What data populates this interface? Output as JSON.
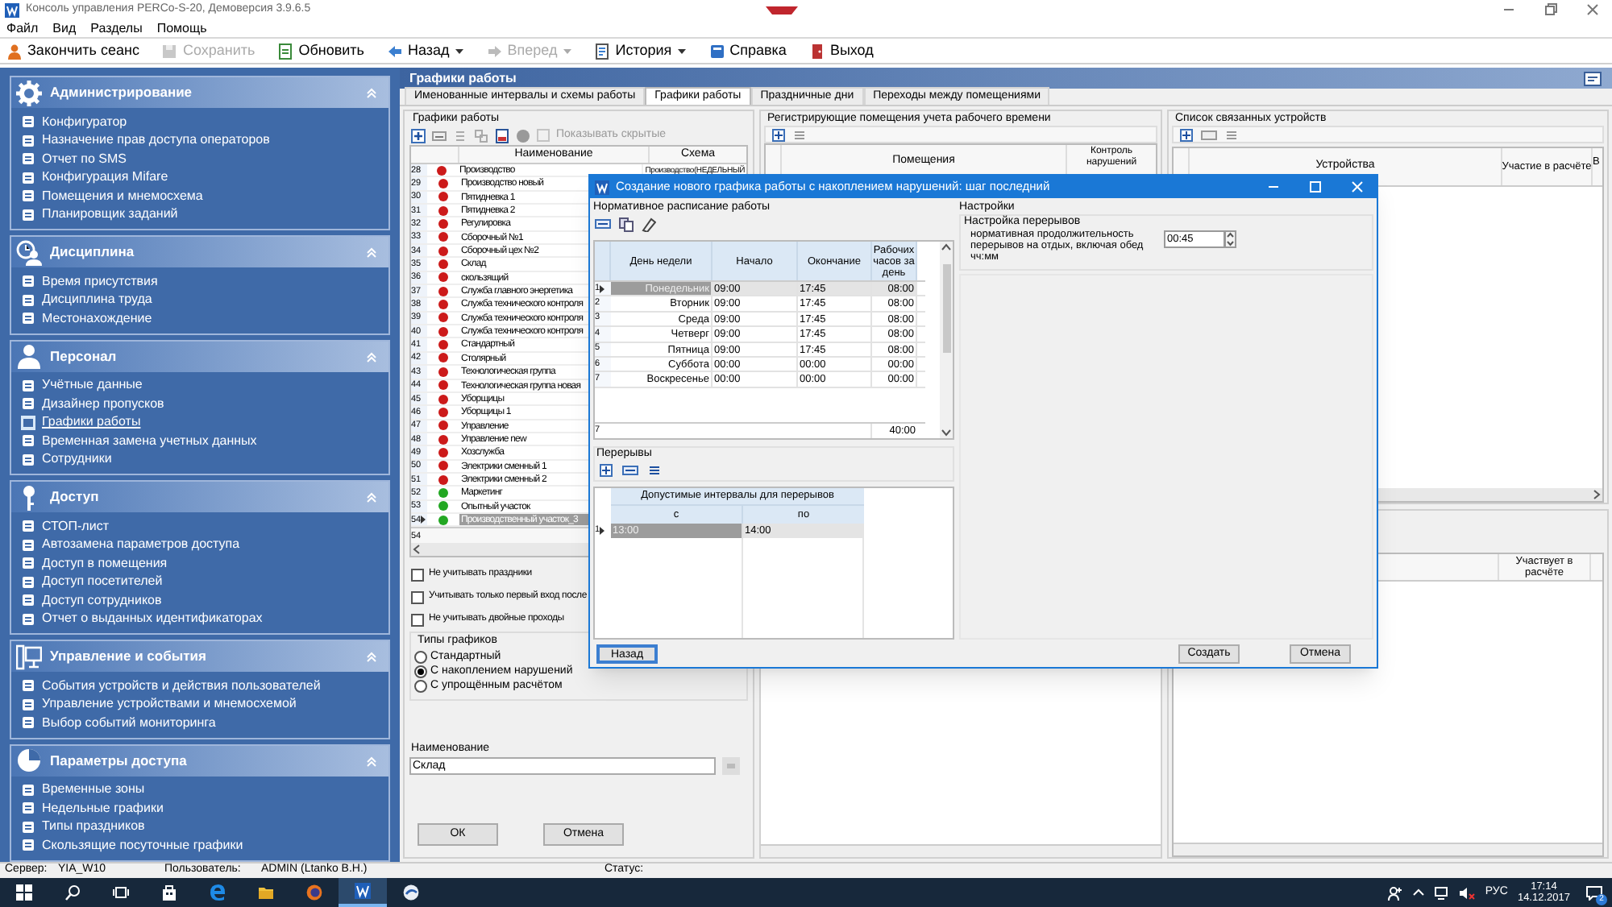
{
  "window": {
    "title": "Консоль управления PERCo-S-20, Демоверсия 3.9.6.5"
  },
  "menu": [
    "Файл",
    "Вид",
    "Разделы",
    "Помощь"
  ],
  "toolbar": [
    {
      "label": "Закончить сеанс",
      "disabled": false,
      "dropdown": false
    },
    {
      "label": "Сохранить",
      "disabled": true,
      "dropdown": false
    },
    {
      "label": "Обновить",
      "disabled": false,
      "dropdown": false
    },
    {
      "label": "Назад",
      "disabled": false,
      "dropdown": true
    },
    {
      "label": "Вперед",
      "disabled": true,
      "dropdown": true
    },
    {
      "label": "История",
      "disabled": false,
      "dropdown": true
    },
    {
      "label": "Справка",
      "disabled": false,
      "dropdown": false
    },
    {
      "label": "Выход",
      "disabled": false,
      "dropdown": false
    }
  ],
  "sidebar": {
    "sections": [
      {
        "title": "Администрирование",
        "items": [
          {
            "label": "Конфигуратор",
            "selected": false
          },
          {
            "label": "Назначение прав доступа операторов",
            "selected": false
          },
          {
            "label": "Отчет по SMS",
            "selected": false
          },
          {
            "label": "Конфигурация Mifare",
            "selected": false
          },
          {
            "label": "Помещения и мнемосхема",
            "selected": false
          },
          {
            "label": "Планировщик заданий",
            "selected": false
          }
        ]
      },
      {
        "title": "Дисциплина",
        "items": [
          {
            "label": "Время присутствия",
            "selected": false
          },
          {
            "label": "Дисциплина труда",
            "selected": false
          },
          {
            "label": "Местонахождение",
            "selected": false
          }
        ]
      },
      {
        "title": "Персонал",
        "items": [
          {
            "label": "Учётные данные",
            "selected": false
          },
          {
            "label": "Дизайнер пропусков",
            "selected": false
          },
          {
            "label": "Графики работы",
            "selected": true
          },
          {
            "label": "Временная замена учетных данных",
            "selected": false
          },
          {
            "label": "Сотрудники",
            "selected": false
          }
        ]
      },
      {
        "title": "Доступ",
        "items": [
          {
            "label": "СТОП-лист",
            "selected": false
          },
          {
            "label": "Автозамена параметров доступа",
            "selected": false
          },
          {
            "label": "Доступ в помещения",
            "selected": false
          },
          {
            "label": "Доступ посетителей",
            "selected": false
          },
          {
            "label": "Доступ сотрудников",
            "selected": false
          },
          {
            "label": "Отчет о выданных идентификаторах",
            "selected": false
          }
        ]
      },
      {
        "title": "Управление и события",
        "items": [
          {
            "label": "События устройств и действия пользователей",
            "selected": false
          },
          {
            "label": "Управление устройствами и мнемосхемой",
            "selected": false
          },
          {
            "label": "Выбор событий мониторинга",
            "selected": false
          }
        ]
      },
      {
        "title": "Параметры доступа",
        "items": [
          {
            "label": "Временные зоны",
            "selected": false
          },
          {
            "label": "Недельные графики",
            "selected": false
          },
          {
            "label": "Типы праздников",
            "selected": false
          },
          {
            "label": "Скользящие посуточные графики",
            "selected": false
          }
        ]
      }
    ]
  },
  "page_title": "Графики работы",
  "tabs": [
    {
      "label": "Именованные интервалы и схемы работы",
      "selected": false
    },
    {
      "label": "Графики работы",
      "selected": true
    },
    {
      "label": "Праздничные дни",
      "selected": false
    },
    {
      "label": "Переходы между помещениями",
      "selected": false
    }
  ],
  "schedules": {
    "title": "Графики работы",
    "show_hidden": {
      "label": "Показывать скрытые",
      "checked": false,
      "disabled": true
    },
    "columns": [
      "Наименование",
      "Схема"
    ],
    "rows": [
      {
        "number": "28",
        "name": "Производство",
        "scheme": "Производство(НЕДЕЛЬНЫЙ",
        "color": "#cc1a1a",
        "selected": false
      },
      {
        "number": "29",
        "name": "Производство новый",
        "color": "#cc1a1a",
        "selected": false
      },
      {
        "number": "30",
        "name": "Пятидневка 1",
        "color": "#cc1a1a",
        "selected": false
      },
      {
        "number": "31",
        "name": "Пятидневка 2",
        "color": "#cc1a1a",
        "selected": false
      },
      {
        "number": "32",
        "name": "Регулировка",
        "color": "#cc1a1a",
        "selected": false
      },
      {
        "number": "33",
        "name": "Сборочный №1",
        "color": "#cc1a1a",
        "selected": false
      },
      {
        "number": "34",
        "name": "Сборочный цех №2",
        "color": "#cc1a1a",
        "selected": false
      },
      {
        "number": "35",
        "name": "Склад",
        "color": "#cc1a1a",
        "selected": false
      },
      {
        "number": "36",
        "name": "скользящий",
        "color": "#cc1a1a",
        "selected": false
      },
      {
        "number": "37",
        "name": "Служба главного энергетика",
        "color": "#cc1a1a",
        "selected": false
      },
      {
        "number": "38",
        "name": "Служба технического контроля",
        "color": "#cc1a1a",
        "selected": false
      },
      {
        "number": "39",
        "name": "Служба технического контроля",
        "color": "#cc1a1a",
        "selected": false
      },
      {
        "number": "40",
        "name": "Служба технического контроля",
        "color": "#cc1a1a",
        "selected": false
      },
      {
        "number": "41",
        "name": "Стандартный",
        "color": "#cc1a1a",
        "selected": false
      },
      {
        "number": "42",
        "name": "Столярный",
        "color": "#cc1a1a",
        "selected": false
      },
      {
        "number": "43",
        "name": "Технологическая группа",
        "color": "#cc1a1a",
        "selected": false
      },
      {
        "number": "44",
        "name": "Технологическая группа новая",
        "color": "#cc1a1a",
        "selected": false
      },
      {
        "number": "45",
        "name": "Уборщицы",
        "color": "#cc1a1a",
        "selected": false
      },
      {
        "number": "46",
        "name": "Уборщицы 1",
        "color": "#cc1a1a",
        "selected": false
      },
      {
        "number": "47",
        "name": "Управление",
        "color": "#cc1a1a",
        "selected": false
      },
      {
        "number": "48",
        "name": "Управление new",
        "color": "#cc1a1a",
        "selected": false
      },
      {
        "number": "49",
        "name": "Хозслужба",
        "color": "#cc1a1a",
        "selected": false
      },
      {
        "number": "50",
        "name": "Электрики сменный 1",
        "color": "#cc1a1a",
        "selected": false
      },
      {
        "number": "51",
        "name": "Электрики сменный 2",
        "color": "#cc1a1a",
        "selected": false
      },
      {
        "number": "52",
        "name": "Маркетинг",
        "color": "#22a722",
        "selected": false
      },
      {
        "number": "53",
        "name": "Опытный участок",
        "color": "#22a722",
        "selected": false
      },
      {
        "number": "54",
        "name": "Производственный участок_3",
        "color": "#22a722",
        "selected": true
      }
    ],
    "footer": "54"
  },
  "options": [
    {
      "label": "Не учитывать праздники",
      "checked": false
    },
    {
      "label": "Учитывать только первый вход после",
      "checked": false
    },
    {
      "label": "Не учитывать двойные проходы",
      "checked": false
    }
  ],
  "schedule_types": {
    "title": "Типы графиков",
    "options": [
      {
        "label": "Стандартный",
        "selected": false
      },
      {
        "label": "С накоплением нарушений",
        "selected": true
      },
      {
        "label": "С упрощённым расчётом",
        "selected": false
      }
    ]
  },
  "name_field": {
    "label": "Наименование",
    "value": "Склад"
  },
  "buttons": [
    "ОК",
    "Отмена"
  ],
  "rooms_panel": {
    "title": "Регистрирующие помещения учета рабочего времени",
    "columns": [
      "Помещения",
      "Контроль нарушений"
    ]
  },
  "devices_panel": {
    "title": "Список связанных устройств",
    "columns": [
      "Устройства",
      "Участие в расчёте",
      "В"
    ]
  },
  "lower_panel": {
    "columns": [
      "Участвует в расчёте"
    ]
  },
  "dialog": {
    "title": "Создание нового графика работы с накоплением нарушений: шаг последний",
    "schedule": {
      "title": "Нормативное расписание работы",
      "columns": [
        "День недели",
        "Начало",
        "Окончание",
        "Рабочих часов за день"
      ],
      "rows": [
        {
          "number": "1",
          "day": "Понедельник",
          "start": "09:00",
          "end": "17:45",
          "hours": "08:00",
          "selected": true
        },
        {
          "number": "2",
          "day": "Вторник",
          "start": "09:00",
          "end": "17:45",
          "hours": "08:00",
          "selected": false
        },
        {
          "number": "3",
          "day": "Среда",
          "start": "09:00",
          "end": "17:45",
          "hours": "08:00",
          "selected": false
        },
        {
          "number": "4",
          "day": "Четверг",
          "start": "09:00",
          "end": "17:45",
          "hours": "08:00",
          "selected": false
        },
        {
          "number": "5",
          "day": "Пятница",
          "start": "09:00",
          "end": "17:45",
          "hours": "08:00",
          "selected": false
        },
        {
          "number": "6",
          "day": "Суббота",
          "start": "00:00",
          "end": "00:00",
          "hours": "00:00",
          "selected": false
        },
        {
          "number": "7",
          "day": "Воскресенье",
          "start": "00:00",
          "end": "00:00",
          "hours": "00:00",
          "selected": false
        }
      ],
      "total": {
        "number": "7",
        "hours": "40:00"
      }
    },
    "breaks": {
      "title": "Перерывы",
      "header": "Допустимые интервалы для перерывов",
      "columns": [
        "с",
        "по"
      ],
      "rows": [
        {
          "number": "1",
          "from": "13:00",
          "to": "14:00",
          "selected": true
        }
      ]
    },
    "settings": {
      "title": "Настройки",
      "group": "Настройка перерывов",
      "label": "нормативная продолжительность перерывов на отдых, включая обед чч:мм",
      "value": "00:45"
    },
    "buttons": [
      {
        "label": "Назад",
        "kind": "default"
      },
      {
        "label": "Создать",
        "kind": "normal"
      },
      {
        "label": "Отмена",
        "kind": "normal"
      }
    ]
  },
  "status_bar": {
    "server_label": "Сервер:",
    "server": "YIA_W10",
    "user_label": "Пользователь:",
    "user": "ADMIN (Ltanko B.H.)",
    "status_label": "Статус:"
  },
  "taskbar": {
    "apps": [
      {
        "kind": "start",
        "selected": false
      },
      {
        "kind": "search",
        "selected": false
      },
      {
        "kind": "taskview",
        "selected": false
      },
      {
        "kind": "store",
        "selected": false
      },
      {
        "kind": "edge",
        "selected": false
      },
      {
        "kind": "folder",
        "selected": false
      },
      {
        "kind": "firefox",
        "selected": false
      },
      {
        "kind": "app",
        "selected": true
      },
      {
        "kind": "app2",
        "selected": false
      }
    ],
    "language": "РУС",
    "time": "17:14",
    "date": "14.12.2017",
    "notifications": "2"
  }
}
